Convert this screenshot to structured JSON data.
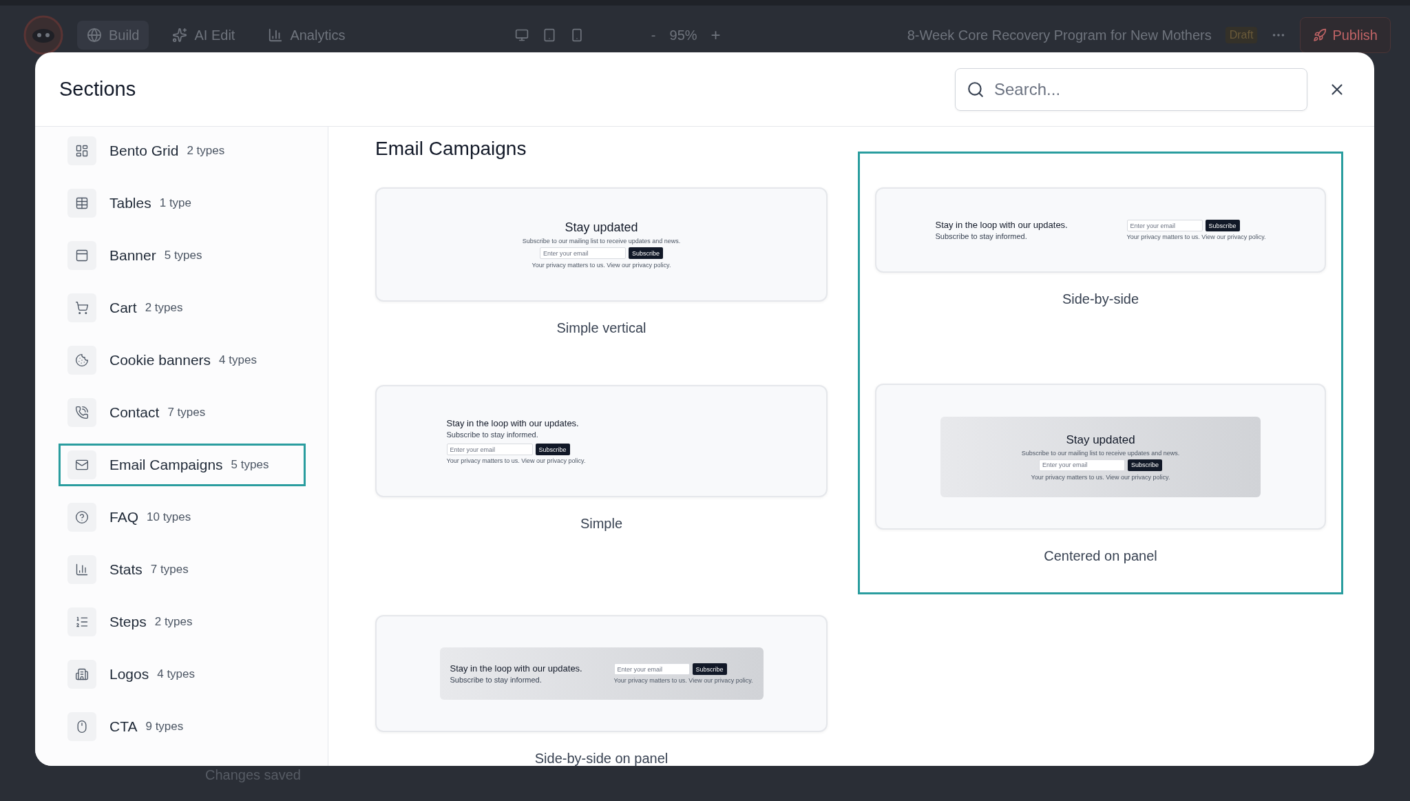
{
  "app_bar": {
    "menu": [
      {
        "label": "Build",
        "selected": true
      },
      {
        "label": "AI Edit",
        "selected": false
      },
      {
        "label": "Analytics",
        "selected": false
      }
    ],
    "zoom": {
      "minus": "-",
      "value": "95%",
      "plus": "+"
    },
    "page_title": "8-Week Core Recovery Program for New Mothers",
    "status_badge": "Draft",
    "publish": "Publish"
  },
  "status": "Changes saved",
  "dialog": {
    "title": "Sections",
    "search": {
      "placeholder": "Search..."
    },
    "categories": [
      {
        "name": "Bento Grid",
        "count": "2 types",
        "selected": false
      },
      {
        "name": "Tables",
        "count": "1 type",
        "selected": false
      },
      {
        "name": "Banner",
        "count": "5 types",
        "selected": false
      },
      {
        "name": "Cart",
        "count": "2 types",
        "selected": false
      },
      {
        "name": "Cookie banners",
        "count": "4 types",
        "selected": false
      },
      {
        "name": "Contact",
        "count": "7 types",
        "selected": false
      },
      {
        "name": "Email Campaigns",
        "count": "5 types",
        "selected": true
      },
      {
        "name": "FAQ",
        "count": "10 types",
        "selected": false
      },
      {
        "name": "Stats",
        "count": "7 types",
        "selected": false
      },
      {
        "name": "Steps",
        "count": "2 types",
        "selected": false
      },
      {
        "name": "Logos",
        "count": "4 types",
        "selected": false
      },
      {
        "name": "CTA",
        "count": "9 types",
        "selected": false
      }
    ],
    "heading": "Email Campaigns",
    "templates": [
      {
        "label": "Simple vertical",
        "kind": "vertical",
        "headline": "Stay updated",
        "subline": "Subscribe to our mailing list to receive updates and news.",
        "placeholder": "Enter your email",
        "button": "Subscribe",
        "privacy": "Your privacy matters to us. View our privacy policy."
      },
      {
        "label": "Simple",
        "kind": "stacked",
        "headline": "Stay in the loop with our updates.",
        "subline": "Subscribe to stay informed.",
        "placeholder": "Enter your email",
        "button": "Subscribe",
        "privacy": "Your privacy matters to us. View our privacy policy."
      },
      {
        "label": "Side-by-side on panel",
        "kind": "panel-side",
        "headline": "Stay in the loop with our updates.",
        "subline": "Subscribe to stay informed.",
        "placeholder": "Enter your email",
        "button": "Subscribe",
        "privacy": "Your privacy matters to us. View our privacy policy."
      }
    ],
    "highlighted_templates": [
      {
        "label": "Side-by-side",
        "kind": "side",
        "headline": "Stay in the loop with our updates.",
        "subline": "Subscribe to stay informed.",
        "placeholder": "Enter your email",
        "button": "Subscribe",
        "privacy": "Your privacy matters to us. View our privacy policy."
      },
      {
        "label": "Centered on panel",
        "kind": "panel-vertical",
        "headline": "Stay updated",
        "subline": "Subscribe to our mailing list to receive updates and news.",
        "placeholder": "Enter your email",
        "button": "Subscribe",
        "privacy": "Your privacy matters to us. View our privacy policy."
      }
    ]
  }
}
